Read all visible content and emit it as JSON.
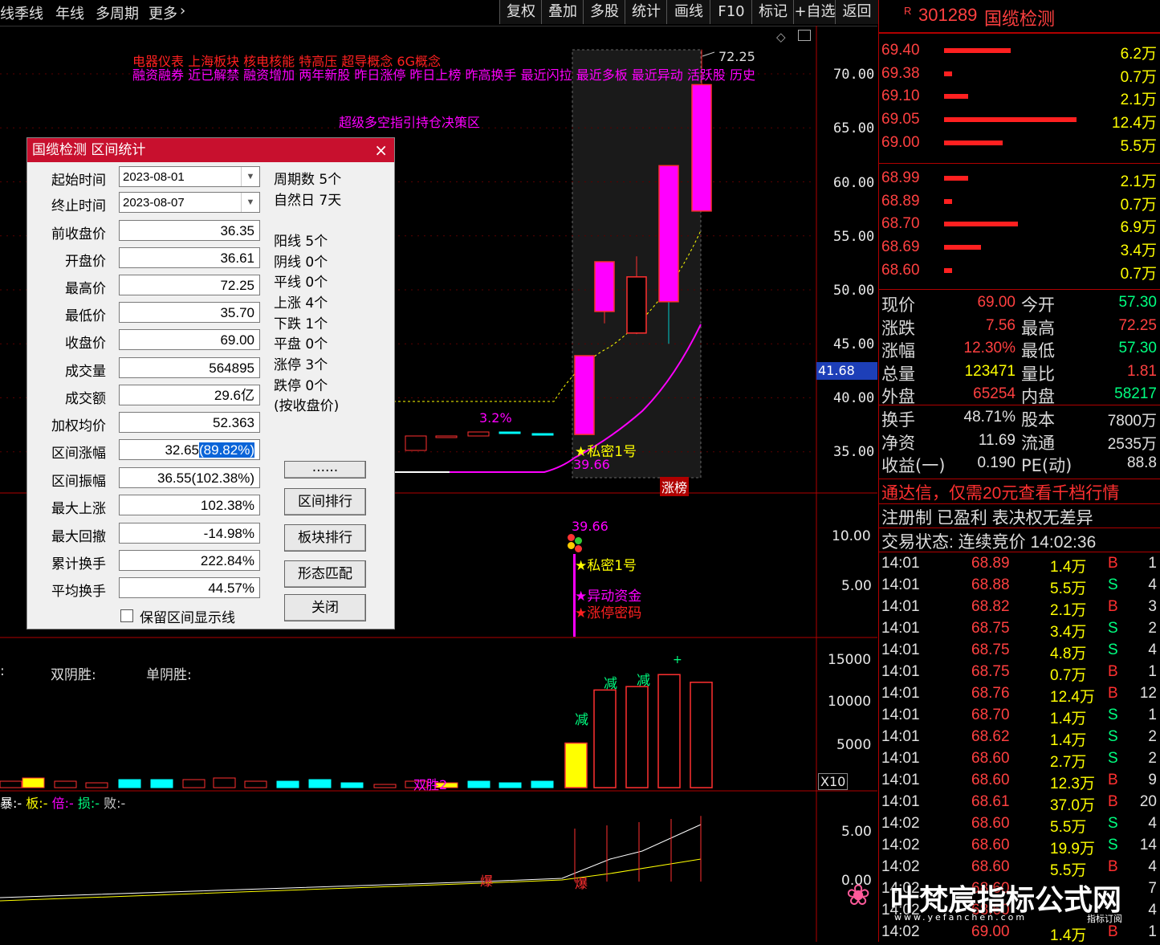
{
  "topbar": {
    "left_items": [
      "线",
      "季线",
      "年线",
      "多周期",
      "更多"
    ],
    "right_buttons": [
      "复权",
      "叠加",
      "多股",
      "统计",
      "画线",
      "F10",
      "标记",
      "+自选",
      "返回"
    ]
  },
  "chart": {
    "concept_line1": "电器仪表  上海板块  核电核能 特高压  超导概念 6G概念",
    "concept_line2": "融资融券 近已解禁 融资增加 两年新股 昨日涨停 昨日上榜 昨高换手 最近闪拉 最近多板 最近异动 活跃股 历史",
    "indicator_text": "超级多空指引持仓决策区",
    "high_label": "72.25",
    "price_axis": [
      "70.00",
      "65.00",
      "60.00",
      "55.00",
      "50.00",
      "45.00",
      "40.00",
      "35.00"
    ],
    "current_marker": "41.68",
    "pct_label": "3.2%",
    "secret_label": "★私密1号",
    "secret_value": "39.66",
    "zhangbang": "涨榜",
    "sub1_axis": [
      "10.00",
      "5.00"
    ],
    "sub1_value": "39.66",
    "sub1_labels": [
      "★私密1号",
      "★异动资金",
      "★涨停密码"
    ],
    "vol_title_a": "双阴胜:",
    "vol_title_b": "单阴胜:",
    "vol_axis": [
      "15000",
      "10000",
      "5000"
    ],
    "vol_unit": "X10",
    "vol_mark": "减",
    "vol_mark_top": "+",
    "double_win": "双胜2",
    "bottom_legend": [
      "暴:",
      "板:",
      "倍:",
      "损:",
      "败:"
    ],
    "bottom_legend_val": "-",
    "bottom_axis": [
      "5.00",
      "0.00"
    ],
    "bao_label": "爆",
    "chart_data": {
      "type": "candlestick",
      "high": 72.25,
      "candles": [
        {
          "open": 36.61,
          "close": 43.9,
          "high": 43.9,
          "low": 36.61
        },
        {
          "open": 48.0,
          "close": 52.6,
          "high": 52.6,
          "low": 46.9
        },
        {
          "open": 51.2,
          "close": 46.0,
          "high": 53.1,
          "low": 45.9
        },
        {
          "open": 48.9,
          "close": 61.5,
          "high": 61.5,
          "low": 45.0
        },
        {
          "open": 57.3,
          "close": 69.0,
          "high": 72.25,
          "low": 57.3
        }
      ],
      "volume_x10": [
        5200,
        11400,
        11800,
        13200,
        12300
      ]
    }
  },
  "dialog": {
    "title": "国缆检测 区间统计",
    "close_icon": "×",
    "fields": [
      {
        "label": "起始时间",
        "value": "2023-08-01",
        "date": true
      },
      {
        "label": "终止时间",
        "value": "2023-08-07",
        "date": true
      },
      {
        "label": "前收盘价",
        "value": "36.35"
      },
      {
        "label": "开盘价",
        "value": "36.61"
      },
      {
        "label": "最高价",
        "value": "72.25"
      },
      {
        "label": "最低价",
        "value": "35.70"
      },
      {
        "label": "收盘价",
        "value": "69.00"
      },
      {
        "label": "成交量",
        "value": "564895"
      },
      {
        "label": "成交额",
        "value": "29.6亿"
      },
      {
        "label": "加权均价",
        "value": "52.363"
      },
      {
        "label": "区间涨幅",
        "value": "32.65",
        "value_hl": "(89.82%)"
      },
      {
        "label": "区间振幅",
        "value": "36.55(102.38%)"
      },
      {
        "label": "最大上涨",
        "value": "102.38%"
      },
      {
        "label": "最大回撤",
        "value": "-14.98%"
      },
      {
        "label": "累计换手",
        "value": "222.84%"
      },
      {
        "label": "平均换手",
        "value": "44.57%"
      }
    ],
    "stats": [
      "周期数 5个",
      "自然日 7天",
      "阳线 5个",
      "阴线 0个",
      "平线 0个",
      "上涨 4个",
      "下跌 1个",
      "平盘 0个",
      "涨停 3个",
      "跌停 0个",
      "(按收盘价)"
    ],
    "buttons": [
      "......",
      "区间排行",
      "板块排行",
      "形态匹配",
      "关闭"
    ],
    "checkbox_label": "保留区间显示线"
  },
  "right": {
    "code": "301289",
    "name": "国缆检测",
    "r_badge": "R",
    "asks": [
      {
        "price": "69.40",
        "vol": "6.2万",
        "bar": 0.25
      },
      {
        "price": "69.38",
        "vol": "0.7万",
        "bar": 0.03
      },
      {
        "price": "69.10",
        "vol": "2.1万",
        "bar": 0.09
      },
      {
        "price": "69.05",
        "vol": "12.4万",
        "bar": 0.5
      },
      {
        "price": "69.00",
        "vol": "5.5万",
        "bar": 0.22
      }
    ],
    "bids": [
      {
        "price": "68.99",
        "vol": "2.1万",
        "bar": 0.09
      },
      {
        "price": "68.89",
        "vol": "0.7万",
        "bar": 0.03
      },
      {
        "price": "68.70",
        "vol": "6.9万",
        "bar": 0.28
      },
      {
        "price": "68.69",
        "vol": "3.4万",
        "bar": 0.14
      },
      {
        "price": "68.60",
        "vol": "0.7万",
        "bar": 0.03
      }
    ],
    "quote": [
      {
        "l1": "现价",
        "v1": "69.00",
        "c1": "#ff4040",
        "l2": "今开",
        "v2": "57.30",
        "c2": "#00ff80"
      },
      {
        "l1": "涨跌",
        "v1": "7.56",
        "c1": "#ff4040",
        "l2": "最高",
        "v2": "72.25",
        "c2": "#ff4040"
      },
      {
        "l1": "涨幅",
        "v1": "12.30%",
        "c1": "#ff4040",
        "l2": "最低",
        "v2": "57.30",
        "c2": "#00ff80"
      },
      {
        "l1": "总量",
        "v1": "123471",
        "c1": "#ffff00",
        "l2": "量比",
        "v2": "1.81",
        "c2": "#ff4040"
      },
      {
        "l1": "外盘",
        "v1": "65254",
        "c1": "#ff4040",
        "l2": "内盘",
        "v2": "58217",
        "c2": "#00ff80"
      },
      {
        "l1": "换手",
        "v1": "48.71%",
        "c1": "#e0e0e0",
        "l2": "股本",
        "v2": "7800万",
        "c2": "#e0e0e0"
      },
      {
        "l1": "净资",
        "v1": "11.69",
        "c1": "#e0e0e0",
        "l2": "流通",
        "v2": "2535万",
        "c2": "#e0e0e0"
      },
      {
        "l1": "收益(一)",
        "v1": "0.190",
        "c1": "#e0e0e0",
        "l2": "PE(动)",
        "v2": "88.8",
        "c2": "#e0e0e0"
      }
    ],
    "promo": "通达信，仅需20元查看千档行情",
    "reg": "注册制 已盈利 表决权无差异",
    "trade_status": "交易状态: 连续竞价 14:02:36",
    "ticks": [
      {
        "t": "14:01",
        "p": "68.89",
        "v": "1.4万",
        "s": "B",
        "n": "1"
      },
      {
        "t": "14:01",
        "p": "68.88",
        "v": "5.5万",
        "s": "S",
        "n": "4"
      },
      {
        "t": "14:01",
        "p": "68.82",
        "v": "2.1万",
        "s": "B",
        "n": "3"
      },
      {
        "t": "14:01",
        "p": "68.75",
        "v": "3.4万",
        "s": "S",
        "n": "2"
      },
      {
        "t": "14:01",
        "p": "68.75",
        "v": "4.8万",
        "s": "S",
        "n": "4"
      },
      {
        "t": "14:01",
        "p": "68.75",
        "v": "0.7万",
        "s": "B",
        "n": "1"
      },
      {
        "t": "14:01",
        "p": "68.76",
        "v": "12.4万",
        "s": "B",
        "n": "12"
      },
      {
        "t": "14:01",
        "p": "68.70",
        "v": "1.4万",
        "s": "S",
        "n": "1"
      },
      {
        "t": "14:01",
        "p": "68.62",
        "v": "1.4万",
        "s": "S",
        "n": "2"
      },
      {
        "t": "14:01",
        "p": "68.60",
        "v": "2.7万",
        "s": "S",
        "n": "2"
      },
      {
        "t": "14:01",
        "p": "68.60",
        "v": "12.3万",
        "s": "B",
        "n": "9"
      },
      {
        "t": "14:01",
        "p": "68.61",
        "v": "37.0万",
        "s": "B",
        "n": "20"
      },
      {
        "t": "14:02",
        "p": "68.60",
        "v": "5.5万",
        "s": "S",
        "n": "4"
      },
      {
        "t": "14:02",
        "p": "68.60",
        "v": "19.9万",
        "s": "S",
        "n": "14"
      },
      {
        "t": "14:02",
        "p": "68.60",
        "v": "5.5万",
        "s": "B",
        "n": "4"
      },
      {
        "t": "14:02",
        "p": "68.60",
        "v": "",
        "s": "",
        "n": "7"
      },
      {
        "t": "14:02",
        "p": "68.60",
        "v": "",
        "s": "",
        "n": "4"
      },
      {
        "t": "14:02",
        "p": "69.00",
        "v": "1.4万",
        "s": "B",
        "n": "1"
      }
    ],
    "watermark": "叶梵宸指标公式网",
    "watermark_url": "www.yefanchen.com",
    "watermark_tag": "指标订阅"
  }
}
